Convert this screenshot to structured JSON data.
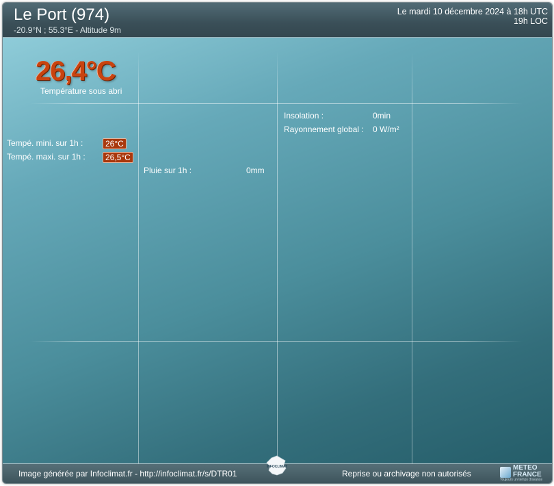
{
  "header": {
    "station_name": "Le Port (974)",
    "coordinates": "-20.9°N ; 55.3°E - Altitude 9m",
    "date_utc": "Le mardi 10 décembre 2024 à 18h UTC",
    "local_time": "19h LOC"
  },
  "temperature": {
    "value": "26,4°C",
    "label": "Température sous abri"
  },
  "temp_min": {
    "label": "Tempé. mini. sur 1h :",
    "value": "26°C"
  },
  "temp_max": {
    "label": "Tempé. maxi. sur 1h :",
    "value": "26,5°C"
  },
  "rain": {
    "label": "Pluie sur 1h :",
    "value": "0mm"
  },
  "insolation": {
    "label": "Insolation :",
    "value": "0min"
  },
  "radiation": {
    "label": "Rayonnement global :",
    "value": "0 W/m²"
  },
  "footer": {
    "credit": "Image générée par Infoclimat.fr - http://infoclimat.fr/s/DTR01",
    "notice": "Reprise ou archivage non autorisés",
    "infoclimat_logo_text": "INFOCLIMAT",
    "meteofrance_logo_line1": "METEO",
    "meteofrance_logo_line2": "FRANCE",
    "meteofrance_tagline": "Toujours un temps d'avance"
  },
  "colors": {
    "temp_badge": "#a9380d",
    "big_temp": "#c9430f",
    "header_bg": "#3a4f58",
    "panel_top": "#8fccd9",
    "panel_bottom": "#255d69"
  }
}
